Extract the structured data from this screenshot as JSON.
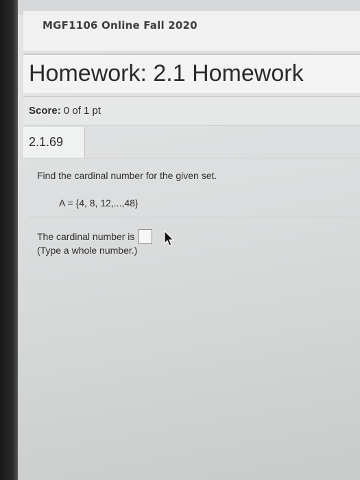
{
  "course": {
    "title": "MGF1106 Online Fall 2020"
  },
  "homework": {
    "title": "Homework: 2.1 Homework"
  },
  "score": {
    "label": "Score:",
    "value": "0 of 1 pt"
  },
  "question": {
    "number": "2.1.69",
    "prompt": "Find the cardinal number for the given set.",
    "set": "A = {4, 8, 12,...,48}",
    "answer_label": "The cardinal number is",
    "answer_value": "",
    "hint": "(Type a whole number.)"
  }
}
